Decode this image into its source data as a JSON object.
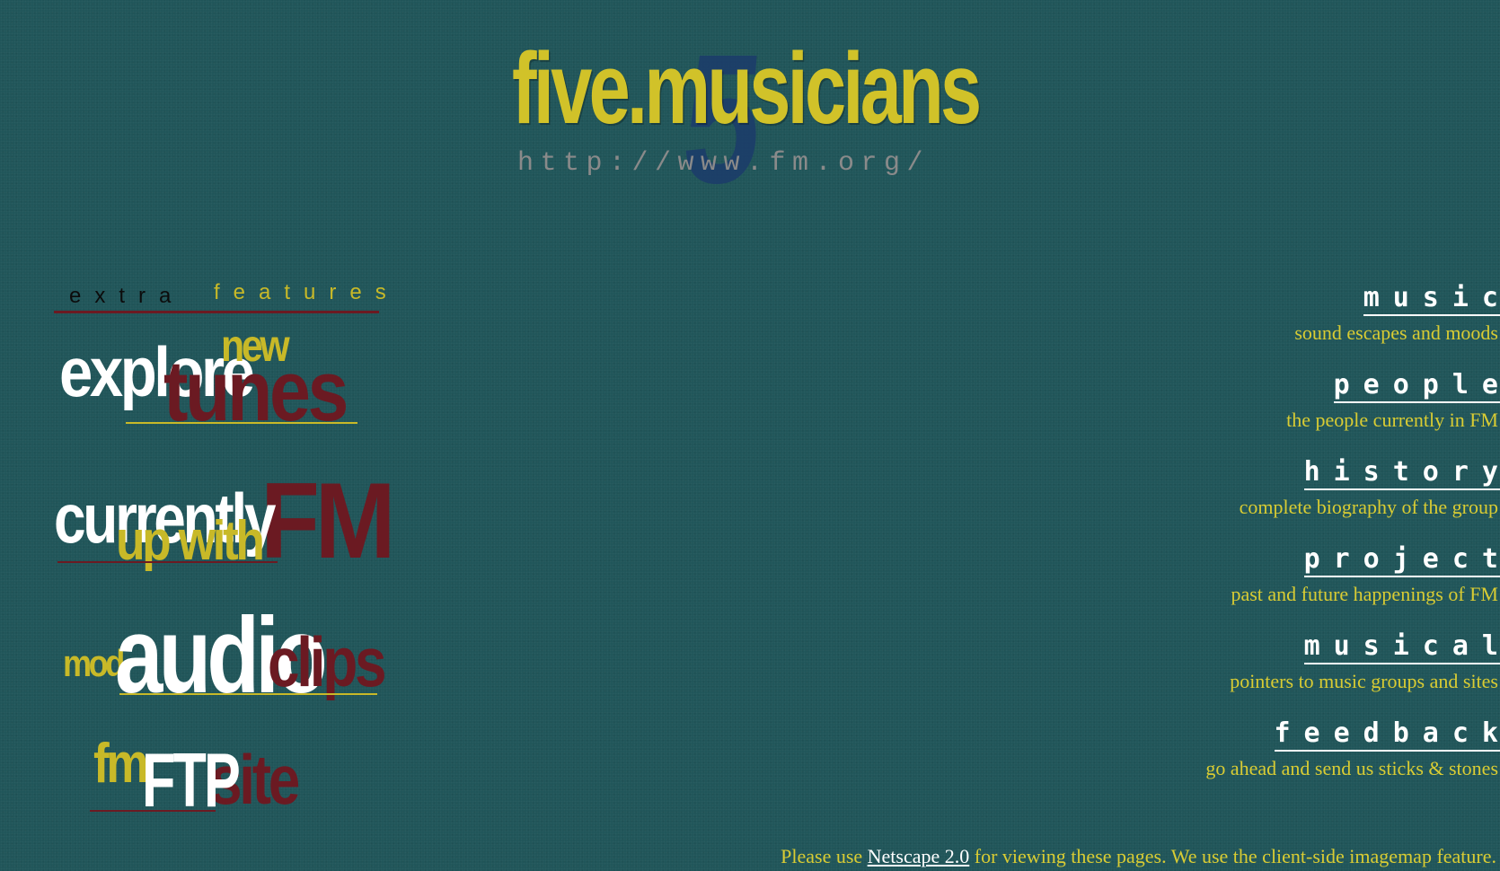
{
  "logo": {
    "title": "five.musicians",
    "url": "http://www.fm.org/",
    "mark": "5"
  },
  "extra_features": {
    "heading_part1": "extra",
    "heading_part2": "features",
    "items": [
      {
        "parts": [
          "explore",
          "new",
          "tunes"
        ]
      },
      {
        "parts": [
          "currently",
          "FM",
          "up with"
        ]
      },
      {
        "parts": [
          "mod",
          "audio",
          "clips"
        ]
      },
      {
        "parts": [
          "fm",
          "FTP",
          "site"
        ]
      }
    ]
  },
  "nav": [
    {
      "label": "music",
      "desc": "sound escapes and moods"
    },
    {
      "label": "people",
      "desc": "the people currently in FM"
    },
    {
      "label": "history",
      "desc": "complete biography of the group"
    },
    {
      "label": "project",
      "desc": "past and future happenings of FM"
    },
    {
      "label": "musical",
      "desc": "pointers to music groups and sites"
    },
    {
      "label": "feedback",
      "desc": "go ahead and send us sticks & stones"
    }
  ],
  "footer": {
    "before": "Please use ",
    "link": "Netscape 2.0",
    "after": " for viewing these pages. We use the client-side imagemap feature."
  },
  "colors": {
    "background": "#1f5559",
    "yellow": "#d1c229",
    "maroon": "#6b1a22",
    "white": "#ffffff"
  }
}
